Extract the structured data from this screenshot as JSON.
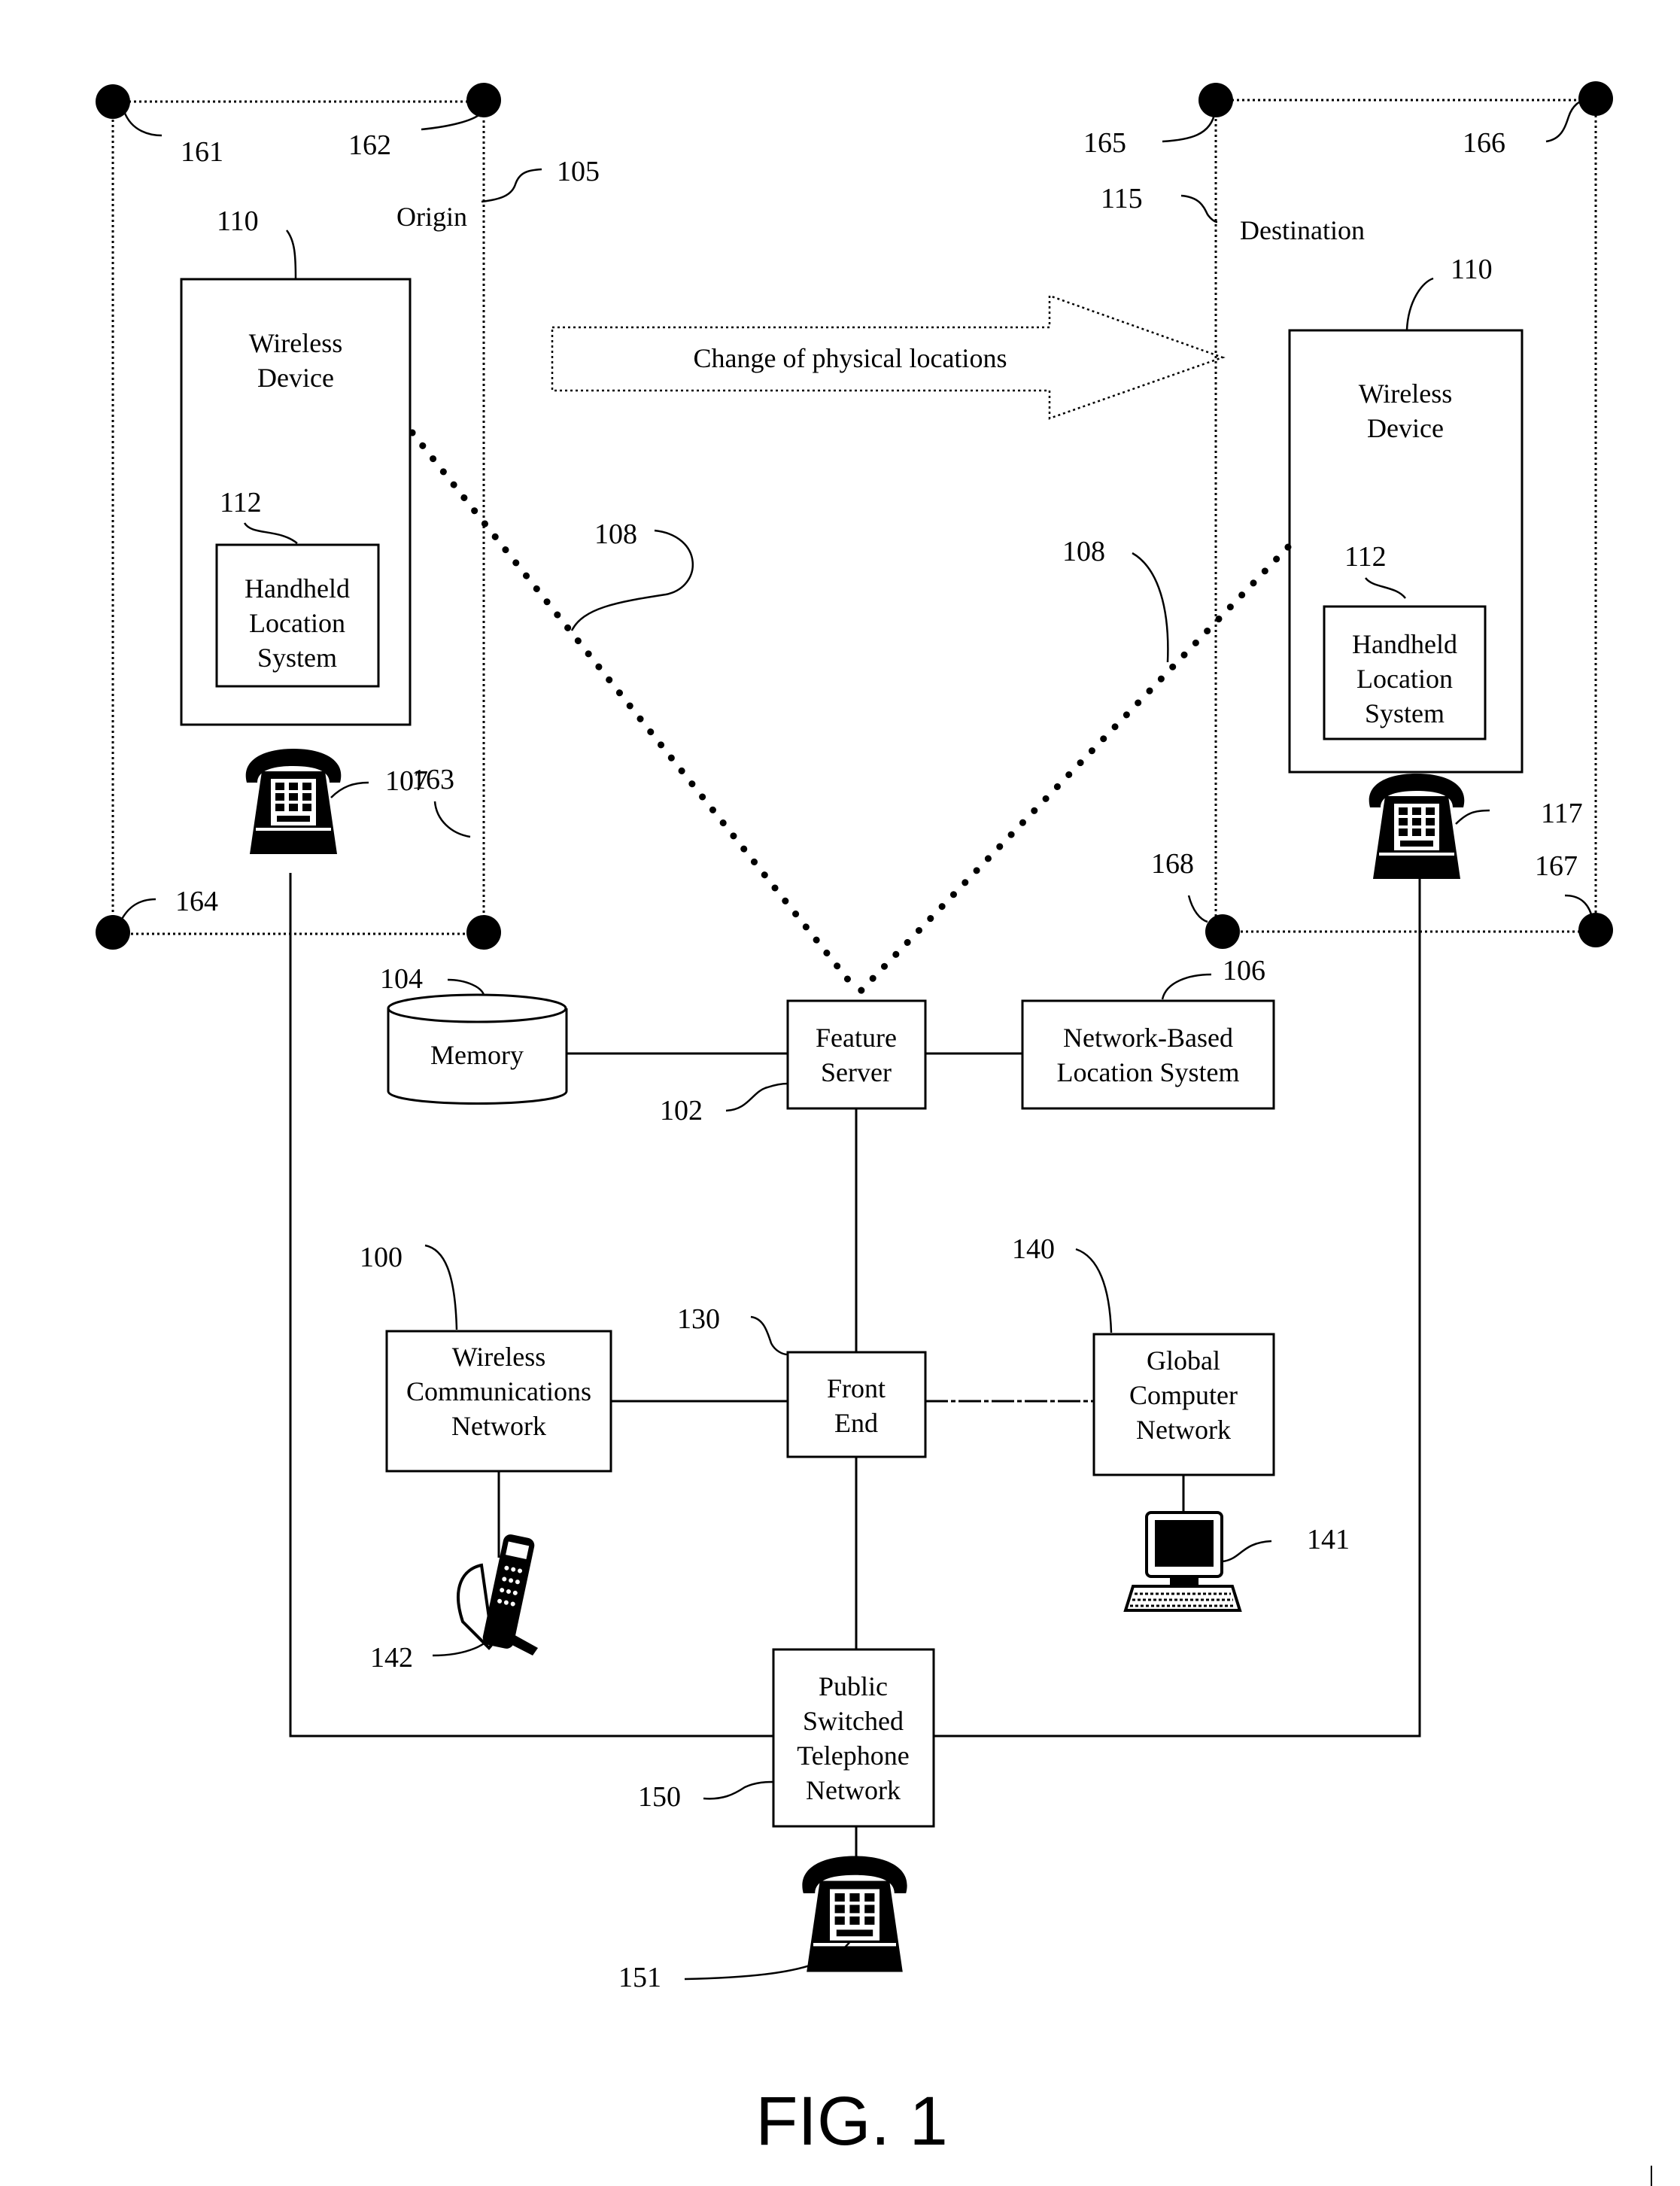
{
  "figure": {
    "caption": "FIG. 1",
    "arrow_label": "Change of physical locations"
  },
  "origin": {
    "label": "Origin",
    "ref": "105",
    "corners": [
      "161",
      "162",
      "163",
      "164"
    ],
    "wireless_device": {
      "ref": "110",
      "lines": [
        "Wireless",
        "Device"
      ]
    },
    "location_system": {
      "ref": "112",
      "lines": [
        "Handheld",
        "Location",
        "System"
      ]
    },
    "phone_ref": "107"
  },
  "destination": {
    "label": "Destination",
    "ref": "115",
    "corners": [
      "165",
      "166",
      "167",
      "168"
    ],
    "wireless_device": {
      "ref": "110",
      "lines": [
        "Wireless",
        "Device"
      ]
    },
    "location_system": {
      "ref": "112",
      "lines": [
        "Handheld",
        "Location",
        "System"
      ]
    },
    "phone_ref": "117"
  },
  "links": {
    "wireless_link_ref_left": "108",
    "wireless_link_ref_right": "108"
  },
  "nodes": {
    "memory": {
      "ref": "104",
      "lines": [
        "Memory"
      ]
    },
    "feature_server": {
      "ref": "102",
      "lines": [
        "Feature",
        "Server"
      ]
    },
    "network_location": {
      "ref": "106",
      "lines": [
        "Network-Based",
        "Location System"
      ]
    },
    "wireless_network": {
      "ref": "100",
      "lines": [
        "Wireless",
        "Communications",
        "Network"
      ]
    },
    "front_end": {
      "ref": "130",
      "lines": [
        "Front",
        "End"
      ]
    },
    "global_network": {
      "ref": "140",
      "lines": [
        "Global",
        "Computer",
        "Network"
      ]
    },
    "pstn": {
      "ref": "150",
      "lines": [
        "Public",
        "Switched",
        "Telephone",
        "Network"
      ]
    }
  },
  "devices": {
    "computer_ref": "141",
    "handset_ref": "142",
    "pstn_phone_ref": "151"
  }
}
